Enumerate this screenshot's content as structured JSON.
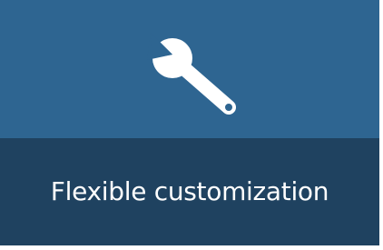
{
  "tile": {
    "label": "Flexible customization",
    "icon": "wrench-icon",
    "colors": {
      "top_background": "#2e6591",
      "bottom_background": "#1f4260",
      "icon": "#ffffff",
      "text": "#ffffff"
    }
  }
}
